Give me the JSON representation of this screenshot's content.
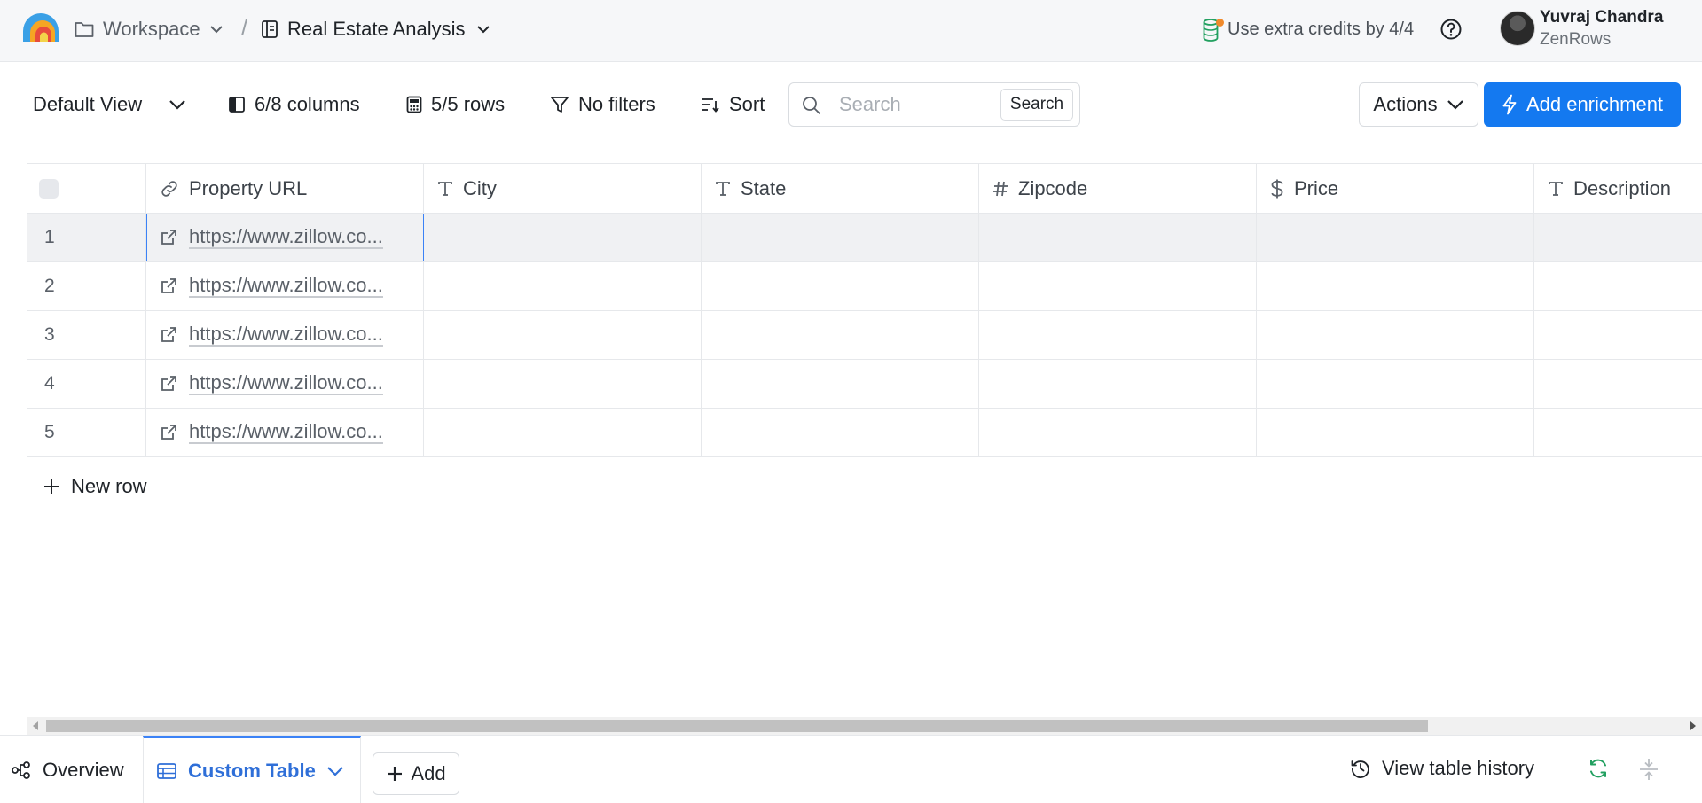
{
  "header": {
    "workspace_label": "Workspace",
    "separator": "/",
    "project_title": "Real Estate Analysis",
    "credits_text": "Use extra credits by 4/4",
    "user_name": "Yuvraj Chandra",
    "user_org": "ZenRows"
  },
  "toolbar": {
    "view_label": "Default View",
    "columns_label": "6/8 columns",
    "rows_label": "5/5 rows",
    "filters_label": "No filters",
    "sort_label": "Sort",
    "search_placeholder": "Search",
    "search_button": "Search",
    "actions_label": "Actions",
    "enrich_label": "Add enrichment"
  },
  "table": {
    "columns": [
      {
        "label": "Property URL",
        "icon": "link-icon"
      },
      {
        "label": "City",
        "icon": "text-type-icon"
      },
      {
        "label": "State",
        "icon": "text-type-icon"
      },
      {
        "label": "Zipcode",
        "icon": "hash-icon"
      },
      {
        "label": "Price",
        "icon": "dollar-icon"
      },
      {
        "label": "Description",
        "icon": "text-type-icon"
      }
    ],
    "rows": [
      {
        "num": "1",
        "url": "https://www.zillow.co..."
      },
      {
        "num": "2",
        "url": "https://www.zillow.co..."
      },
      {
        "num": "3",
        "url": "https://www.zillow.co..."
      },
      {
        "num": "4",
        "url": "https://www.zillow.co..."
      },
      {
        "num": "5",
        "url": "https://www.zillow.co..."
      }
    ],
    "new_row_label": "New row"
  },
  "bottom": {
    "overview_label": "Overview",
    "custom_table_label": "Custom Table",
    "add_label": "Add",
    "history_label": "View table history"
  },
  "colors": {
    "accent": "#1479f0",
    "active_tab": "#2f6fd8",
    "refresh": "#22a060",
    "credit_dot": "#f08a2c"
  }
}
